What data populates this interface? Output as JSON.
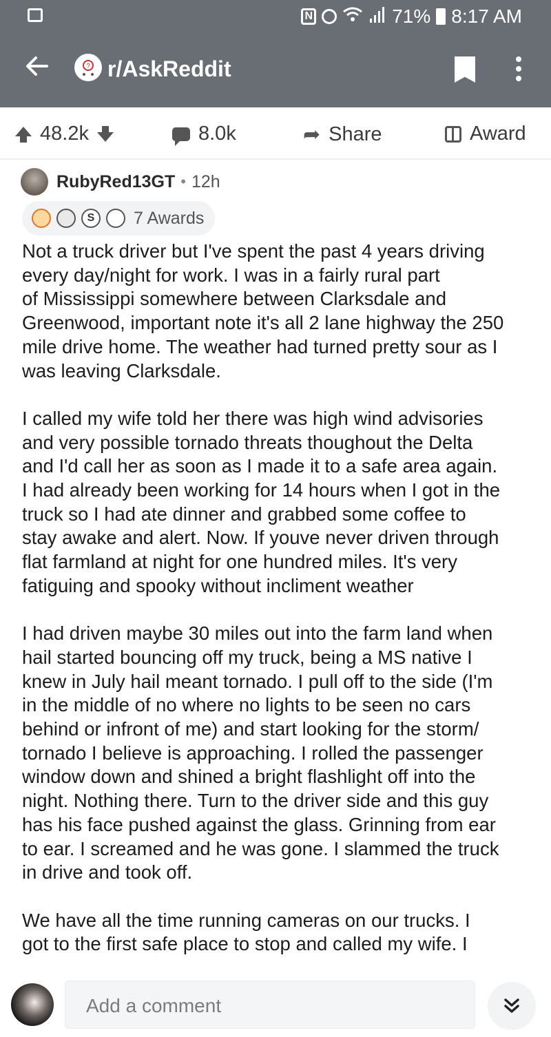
{
  "status_bar": {
    "battery": "71%",
    "time": "8:17 AM",
    "icons": [
      "notification-icon",
      "nfc-icon",
      "alarm-icon",
      "wifi-icon",
      "signal-icon",
      "battery-icon"
    ]
  },
  "header": {
    "subreddit": "r/AskReddit",
    "icons": [
      "back-arrow-icon",
      "subreddit-icon",
      "bookmark-icon",
      "more-options-icon"
    ],
    "color": "#686e74"
  },
  "actions": {
    "upvotes": "48.2k",
    "comments": "8.0k",
    "share": "Share",
    "award": "Award"
  },
  "comment": {
    "author": "RubyRed13GT",
    "age": "12h",
    "awards_label": "7 Awards",
    "paragraphs": [
      "Not a truck driver but I've spent the past 4 years driving\nevery day/night for work. I was in a fairly rural part\nof Mississippi somewhere between Clarksdale and\nGreenwood, important note it's all 2 lane highway the 250\nmile drive home. The weather had turned pretty sour as I\nwas leaving Clarksdale.",
      "I called my wife told her there was high wind advisories\nand very possible tornado threats thoughout the Delta\nand I'd call her as soon as I made it to a safe area again.\nI had already been working for 14 hours when I got in the\ntruck so I had ate dinner and grabbed some coffee to\nstay awake and alert. Now. If youve never driven through\nflat farmland at night for one hundred miles. It's very\nfatiguing and spooky without incliment weather",
      "I had driven maybe 30 miles out into the farm land when\nhail started bouncing off my truck, being a MS native I\nknew in July hail meant tornado. I pull off to the side (I'm\nin the middle of no where no lights to be seen no cars\nbehind or infront of me) and start looking for the storm/\ntornado I believe is approaching. I rolled the passenger\nwindow down and shined a bright flashlight off into the\nnight. Nothing there. Turn to the driver side and this guy\nhas his face pushed against the glass. Grinning from ear\nto ear. I screamed and he was gone. I slammed the truck\nin drive and took off.",
      "We have all the time running cameras on our trucks. I\ngot to the first safe place to stop and called my wife. I"
    ]
  },
  "composer": {
    "placeholder": "Add a comment",
    "icons": [
      "user-avatar",
      "scroll-down-icon"
    ]
  }
}
